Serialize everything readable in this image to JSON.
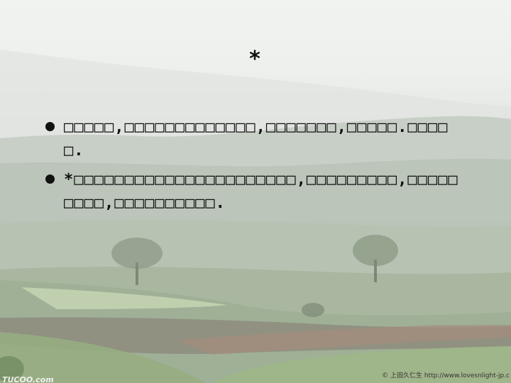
{
  "slide": {
    "title": "*",
    "bullets": [
      "□□□□□,□□□□□□□□□□□□□,□□□□□□□,□□□□□.□□□□□.",
      "*□□□□□□□□□□□□□□□□□□□□□□,□□□□□□□□□,□□□□□□□□□,□□□□□□□□□□."
    ]
  },
  "footer": {
    "credit": "© 上田久仁生   http://www.lovesnlight-jp.c",
    "logo": "TUCOO.com"
  }
}
